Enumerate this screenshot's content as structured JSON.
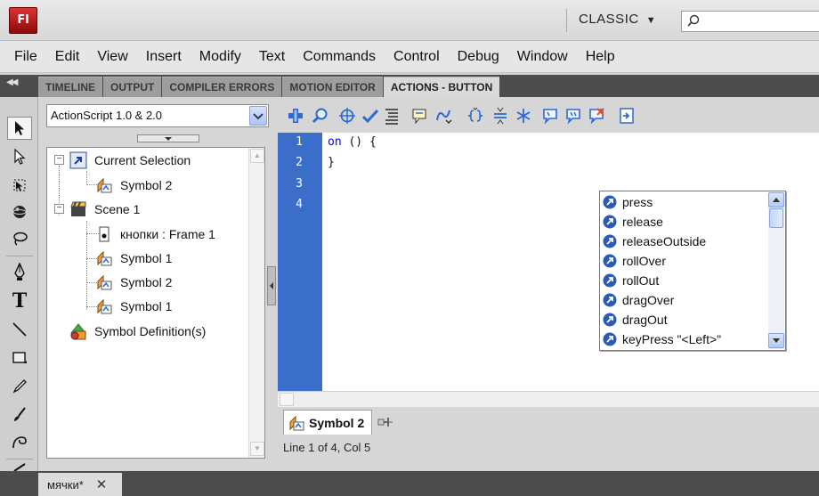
{
  "app": {
    "logo_text": "Fl"
  },
  "workspace": {
    "label": "CLASSIC",
    "caret": "▼"
  },
  "search": {
    "value": ""
  },
  "menu": [
    "File",
    "Edit",
    "View",
    "Insert",
    "Modify",
    "Text",
    "Commands",
    "Control",
    "Debug",
    "Window",
    "Help"
  ],
  "tabs": [
    "TIMELINE",
    "OUTPUT",
    "COMPILER ERRORS",
    "MOTION EDITOR",
    "ACTIONS - BUTTON"
  ],
  "active_tab_index": 4,
  "actions": {
    "version": "ActionScript 1.0 & 2.0",
    "tree": [
      {
        "label": "Current Selection",
        "icon": "selection-icon",
        "expander": "−"
      },
      {
        "label": "Symbol 2",
        "icon": "button-symbol-icon"
      },
      {
        "label": "Scene 1",
        "icon": "scene-icon",
        "expander": "−"
      },
      {
        "label": "кнопки : Frame 1",
        "icon": "frame-icon"
      },
      {
        "label": "Symbol 1",
        "icon": "button-symbol-icon"
      },
      {
        "label": "Symbol 2",
        "icon": "button-symbol-icon"
      },
      {
        "label": "Symbol 1",
        "icon": "button-symbol-icon"
      },
      {
        "label": "Symbol Definition(s)",
        "icon": "symbol-definition-icon"
      }
    ],
    "toolbar_icons": [
      "add-new-item-icon",
      "find-icon",
      "insert-target-path-icon",
      "check-syntax-icon",
      "auto-format-icon",
      "show-code-hint-icon",
      "debug-options-icon",
      "collapse-between-braces-icon",
      "collapse-selection-icon",
      "expand-all-icon",
      "apply-block-comment-icon",
      "apply-line-comment-icon",
      "remove-comment-icon",
      "show-hide-toolbox-icon"
    ],
    "code": {
      "line_numbers": [
        "1",
        "2",
        "3",
        "4"
      ],
      "lines": [
        {
          "keyword": "on",
          "rest": " () {"
        },
        {
          "keyword": "",
          "rest": "}"
        }
      ]
    },
    "code_hints": [
      "press",
      "release",
      "releaseOutside",
      "rollOver",
      "rollOut",
      "dragOver",
      "dragOut",
      "keyPress \"<Left>\""
    ],
    "symbol_tab": "Symbol 2",
    "status": "Line 1 of 4, Col 5"
  },
  "document_tab": {
    "label": "мячки*",
    "close": "✕"
  },
  "colors": {
    "gutter": "#3a6ec8",
    "keyword": "#0000ff",
    "hint_icon": "#2a5bb8"
  }
}
